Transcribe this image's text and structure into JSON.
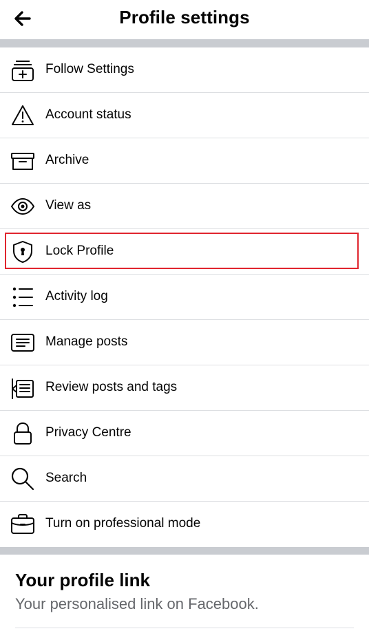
{
  "header": {
    "title": "Profile settings",
    "back_icon": "arrow-left-icon"
  },
  "menu": {
    "highlight_color": "#e0252e",
    "items": [
      {
        "label": "Follow Settings",
        "icon": "follow-settings-icon"
      },
      {
        "label": "Account status",
        "icon": "warning-triangle-icon"
      },
      {
        "label": "Archive",
        "icon": "archive-box-icon"
      },
      {
        "label": "View as",
        "icon": "eye-icon"
      },
      {
        "label": "Lock Profile",
        "icon": "shield-lock-icon",
        "highlighted": true
      },
      {
        "label": "Activity log",
        "icon": "list-icon"
      },
      {
        "label": "Manage posts",
        "icon": "manage-posts-icon"
      },
      {
        "label": "Review posts and tags",
        "icon": "review-posts-icon"
      },
      {
        "label": "Privacy Centre",
        "icon": "padlock-icon"
      },
      {
        "label": "Search",
        "icon": "search-icon"
      },
      {
        "label": "Turn on professional mode",
        "icon": "briefcase-icon"
      }
    ]
  },
  "profile_link": {
    "title": "Your profile link",
    "subtitle": "Your personalised link on Facebook."
  }
}
